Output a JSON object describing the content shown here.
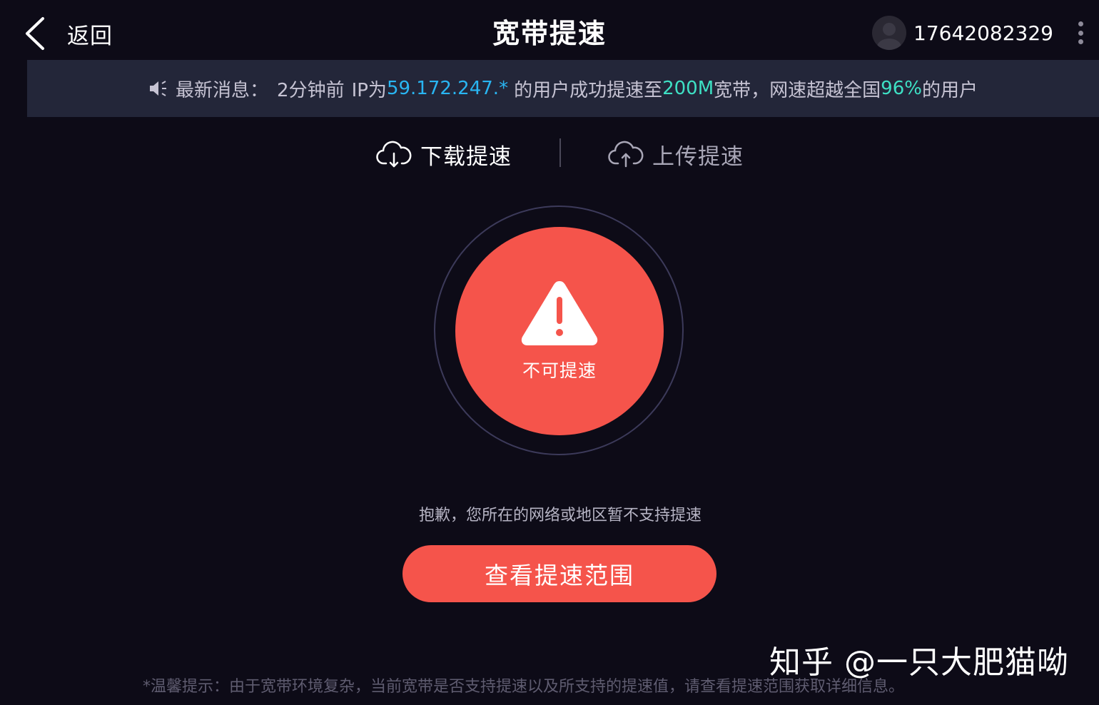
{
  "header": {
    "back_label": "返回",
    "title": "宽带提速",
    "phone": "17642082329"
  },
  "news": {
    "prefix": "最新消息：",
    "time_text": "2分钟前",
    "ip_label": "IP为",
    "ip_value": "59.172.247.*",
    "middle_text": "的用户成功提速至",
    "speed_value": "200M",
    "speed_suffix": "宽带，网速超越全国",
    "percent_value": "96%",
    "end_text": "的用户"
  },
  "tabs": [
    {
      "label": "下载提速",
      "icon": "cloud-download-icon",
      "active": true
    },
    {
      "label": "上传提速",
      "icon": "cloud-upload-icon",
      "active": false
    }
  ],
  "status": {
    "icon": "warning-icon",
    "label": "不可提速"
  },
  "message": "抱歉，您所在的网络或地区暂不支持提速",
  "action_button": "查看提速范围",
  "footer_note": "*温馨提示：由于宽带环境复杂，当前宽带是否支持提速以及所支持的提速值，请查看提速范围获取详细信息。",
  "watermark": "知乎 @一只大肥猫呦",
  "colors": {
    "background": "#0d0b17",
    "banner": "#232639",
    "accent_red": "#f5544b",
    "highlight_blue": "#29b5f2",
    "highlight_green": "#3ee0c4"
  }
}
